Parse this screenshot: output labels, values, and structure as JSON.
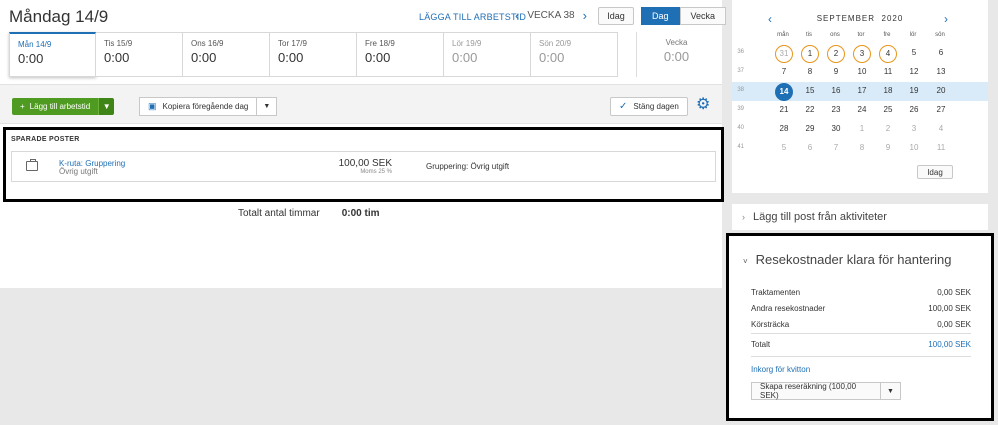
{
  "header": {
    "title": "Måndag 14/9",
    "add_time_link": "LÄGGA TILL ARBETSTID",
    "week_label": "VECKA 38",
    "today_btn": "Idag",
    "view_day": "Dag",
    "view_week": "Vecka"
  },
  "days": [
    {
      "name": "Mån 14/9",
      "value": "0:00"
    },
    {
      "name": "Tis 15/9",
      "value": "0:00"
    },
    {
      "name": "Ons 16/9",
      "value": "0:00"
    },
    {
      "name": "Tor 17/9",
      "value": "0:00"
    },
    {
      "name": "Fre 18/9",
      "value": "0:00"
    },
    {
      "name": "Lör 19/9",
      "value": "0:00"
    },
    {
      "name": "Sön 20/9",
      "value": "0:00"
    }
  ],
  "week_total": {
    "label": "Vecka",
    "value": "0:00"
  },
  "toolbar": {
    "add_time": "Lägg till arbetstid",
    "copy_prev": "Kopiera föregående dag",
    "close_day": "Stäng dagen"
  },
  "saved": {
    "title": "SPARADE POSTER",
    "entry": {
      "name": "K-ruta: Gruppering",
      "sub": "Övrig utgift",
      "amount": "100,00 SEK",
      "vat": "Moms 25 %",
      "desc": "Gruppering: Övrig utgift"
    }
  },
  "total": {
    "label": "Totalt antal timmar",
    "value": "0:00 tim"
  },
  "calendar": {
    "month": "SEPTEMBER",
    "year": "2020",
    "headers": [
      "mån",
      "tis",
      "ons",
      "tor",
      "fre",
      "lör",
      "sön"
    ],
    "weeks": [
      {
        "wk": "36",
        "days": [
          "31",
          "1",
          "2",
          "3",
          "4",
          "5",
          "6"
        ]
      },
      {
        "wk": "37",
        "days": [
          "7",
          "8",
          "9",
          "10",
          "11",
          "12",
          "13"
        ]
      },
      {
        "wk": "38",
        "days": [
          "14",
          "15",
          "16",
          "17",
          "18",
          "19",
          "20"
        ]
      },
      {
        "wk": "39",
        "days": [
          "21",
          "22",
          "23",
          "24",
          "25",
          "26",
          "27"
        ]
      },
      {
        "wk": "40",
        "days": [
          "28",
          "29",
          "30",
          "1",
          "2",
          "3",
          "4"
        ]
      },
      {
        "wk": "41",
        "days": [
          "5",
          "6",
          "7",
          "8",
          "9",
          "10",
          "11"
        ]
      }
    ],
    "today_btn": "Idag",
    "ring_color": "#e8951a",
    "accent": "#1f6fb5"
  },
  "add_from": "Lägg till post från aktiviteter",
  "rese": {
    "title": "Resekostnader klara för hantering",
    "lines": [
      {
        "label": "Traktamenten",
        "value": "0,00 SEK"
      },
      {
        "label": "Andra resekostnader",
        "value": "100,00 SEK"
      },
      {
        "label": "Körsträcka",
        "value": "0,00 SEK"
      }
    ],
    "total": {
      "label": "Totalt",
      "value": "100,00 SEK"
    },
    "inkorg": "Inkorg för kvitton",
    "create": "Skapa reseräkning (100,00 SEK)"
  }
}
